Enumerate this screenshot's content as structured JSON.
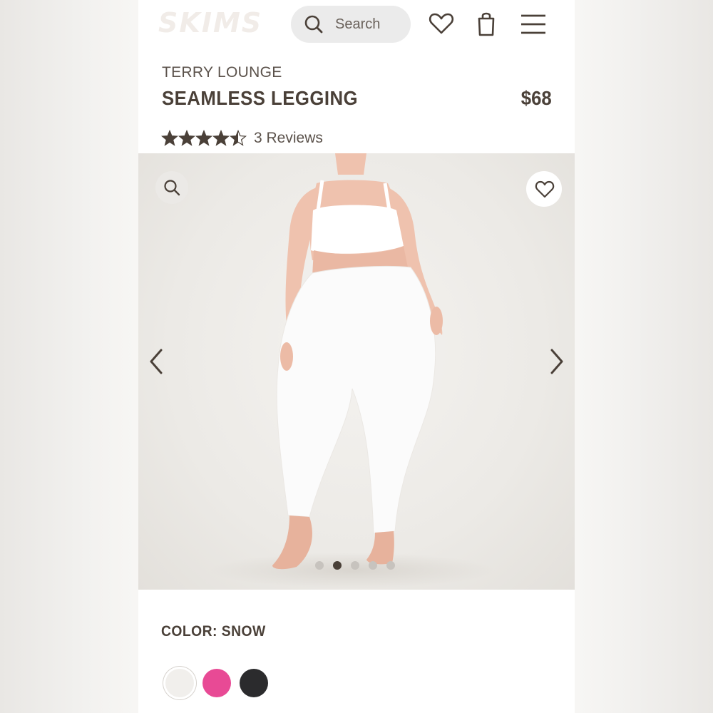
{
  "header": {
    "logo": "SKIMS",
    "search_placeholder": "Search",
    "icons": [
      "search-icon",
      "heart-icon",
      "shopping-bag-icon",
      "menu-icon"
    ]
  },
  "product": {
    "collection": "TERRY LOUNGE",
    "title": "SEAMLESS LEGGING",
    "price": "$68",
    "rating": 4.5,
    "rating_max": 5,
    "reviews_label": "3 Reviews"
  },
  "gallery": {
    "image_count": 5,
    "active_index": 1,
    "icons": [
      "zoom-icon",
      "heart-icon",
      "chevron-left-icon",
      "chevron-right-icon"
    ]
  },
  "color": {
    "label": "COLOR: SNOW",
    "swatches": [
      {
        "name": "Snow",
        "hex": "#f1efec",
        "selected": true
      },
      {
        "name": "Pink",
        "hex": "#e84a95",
        "selected": false
      },
      {
        "name": "Black",
        "hex": "#2b2b2d",
        "selected": false
      }
    ]
  },
  "colors": {
    "text": "#4a4038",
    "accent_dot": "#4a4038",
    "search_bg": "#ebebeb"
  }
}
